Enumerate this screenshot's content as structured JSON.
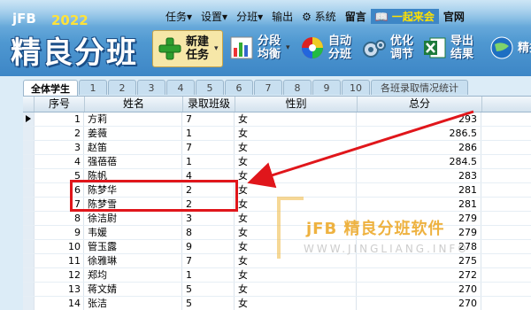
{
  "app": {
    "brand": "jFB",
    "year": "2022",
    "title": "精良分班"
  },
  "menu": [
    {
      "label": "任务▾",
      "bold": false
    },
    {
      "label": "设置▾",
      "bold": false
    },
    {
      "label": "分班▾",
      "bold": false
    },
    {
      "label": "输出",
      "bold": false
    },
    {
      "label": "⚙ 系统",
      "bold": false
    },
    {
      "label": "留言",
      "bold": true
    },
    {
      "label": "📖 一起来会",
      "bold": false,
      "highlight": true
    },
    {
      "label": "官网",
      "bold": true
    }
  ],
  "toolbar": {
    "new_task": "新建任务",
    "segment": "分段均衡",
    "auto": "自动分班",
    "optimize": "优化调节",
    "export": "导出结果",
    "rank": "精排"
  },
  "tabs": [
    "全体学生",
    "1",
    "2",
    "3",
    "4",
    "5",
    "6",
    "7",
    "8",
    "9",
    "10",
    "各班录取情况统计"
  ],
  "table": {
    "headers": {
      "no": "序号",
      "name": "姓名",
      "class": "录取班级",
      "sex": "性别",
      "score": "总分"
    },
    "rows": [
      {
        "no": "1",
        "name": "方莉",
        "class": "7",
        "sex": "女",
        "score": "293"
      },
      {
        "no": "2",
        "name": "姜薇",
        "class": "1",
        "sex": "女",
        "score": "286.5"
      },
      {
        "no": "3",
        "name": "赵笛",
        "class": "7",
        "sex": "女",
        "score": "286"
      },
      {
        "no": "4",
        "name": "强蓓蓓",
        "class": "1",
        "sex": "女",
        "score": "284.5"
      },
      {
        "no": "5",
        "name": "陈帆",
        "class": "4",
        "sex": "女",
        "score": "283"
      },
      {
        "no": "6",
        "name": "陈梦华",
        "class": "2",
        "sex": "女",
        "score": "281"
      },
      {
        "no": "7",
        "name": "陈梦雪",
        "class": "2",
        "sex": "女",
        "score": "281"
      },
      {
        "no": "8",
        "name": "徐洁尉",
        "class": "3",
        "sex": "女",
        "score": "279"
      },
      {
        "no": "9",
        "name": "韦媛",
        "class": "8",
        "sex": "女",
        "score": "279"
      },
      {
        "no": "10",
        "name": "管玉露",
        "class": "9",
        "sex": "女",
        "score": "278"
      },
      {
        "no": "11",
        "name": "徐雅琳",
        "class": "7",
        "sex": "女",
        "score": "275"
      },
      {
        "no": "12",
        "name": "郑均",
        "class": "1",
        "sex": "女",
        "score": "272"
      },
      {
        "no": "13",
        "name": "蒋文婧",
        "class": "5",
        "sex": "女",
        "score": "270"
      },
      {
        "no": "14",
        "name": "张洁",
        "class": "5",
        "sex": "女",
        "score": "270"
      }
    ]
  },
  "watermark": {
    "cn": "jFB 精良分班软件",
    "url": "WWW.JINGLIANG.INFO"
  },
  "colors": {
    "header": "#4f98d1",
    "highlight_box": "#e0161b",
    "watermark": "#eba51e"
  }
}
